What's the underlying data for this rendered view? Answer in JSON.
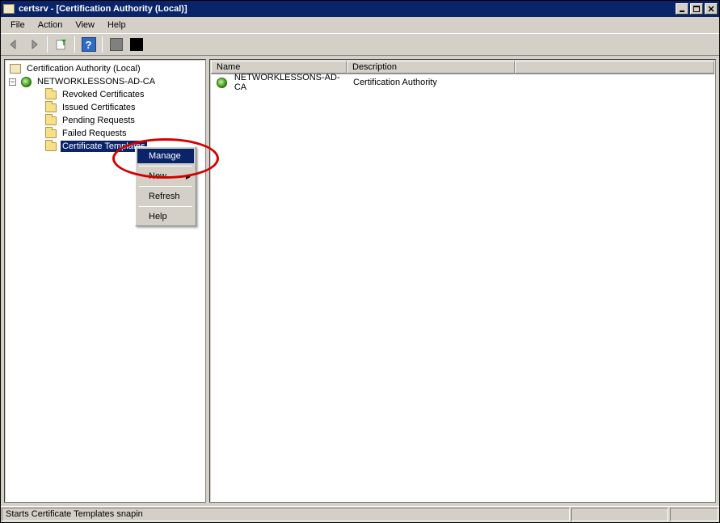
{
  "window": {
    "title": "certsrv - [Certification Authority (Local)]"
  },
  "menubar": {
    "file": "File",
    "action": "Action",
    "view": "View",
    "help": "Help"
  },
  "tree": {
    "root": "Certification Authority (Local)",
    "ca_name": "NETWORKLESSONS-AD-CA",
    "children": [
      "Revoked Certificates",
      "Issued Certificates",
      "Pending Requests",
      "Failed Requests",
      "Certificate Templates"
    ]
  },
  "list": {
    "columns": {
      "name": "Name",
      "description": "Description"
    },
    "rows": [
      {
        "name": "NETWORKLESSONS-AD-CA",
        "description": "Certification Authority"
      }
    ]
  },
  "context_menu": {
    "manage": "Manage",
    "new": "New",
    "refresh": "Refresh",
    "help": "Help"
  },
  "statusbar": {
    "text": "Starts Certificate Templates snapin"
  }
}
